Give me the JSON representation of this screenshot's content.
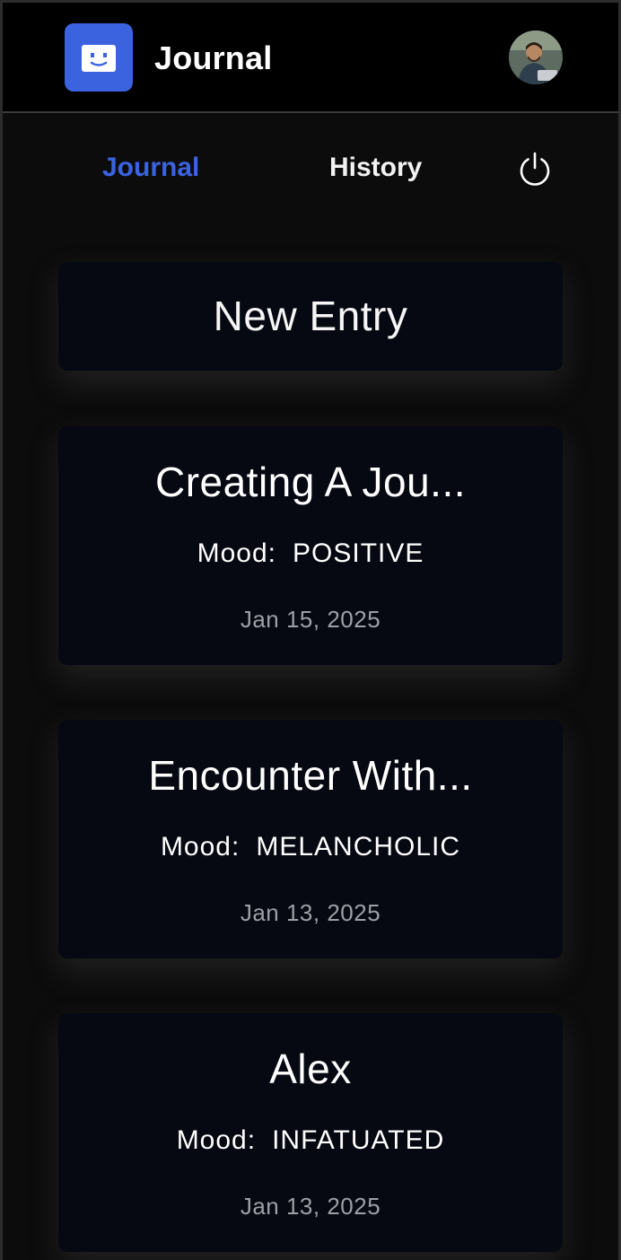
{
  "header": {
    "title": "Journal",
    "logo_icon": "smiley-face-icon",
    "avatar_icon": "user-avatar",
    "accent_color": "#3b63e0"
  },
  "nav": {
    "tabs": [
      {
        "label": "Journal",
        "active": true
      },
      {
        "label": "History",
        "active": false
      }
    ],
    "power_icon": "power-icon"
  },
  "new_entry": {
    "label": "New Entry"
  },
  "entries": [
    {
      "title": "Creating A Jou...",
      "mood_label": "Mood:",
      "mood": "POSITIVE",
      "date": "Jan 15, 2025"
    },
    {
      "title": "Encounter With...",
      "mood_label": "Mood:",
      "mood": "MELANCHOLIC",
      "date": "Jan 13, 2025"
    },
    {
      "title": "Alex",
      "mood_label": "Mood:",
      "mood": "INFATUATED",
      "date": "Jan 13, 2025"
    }
  ]
}
